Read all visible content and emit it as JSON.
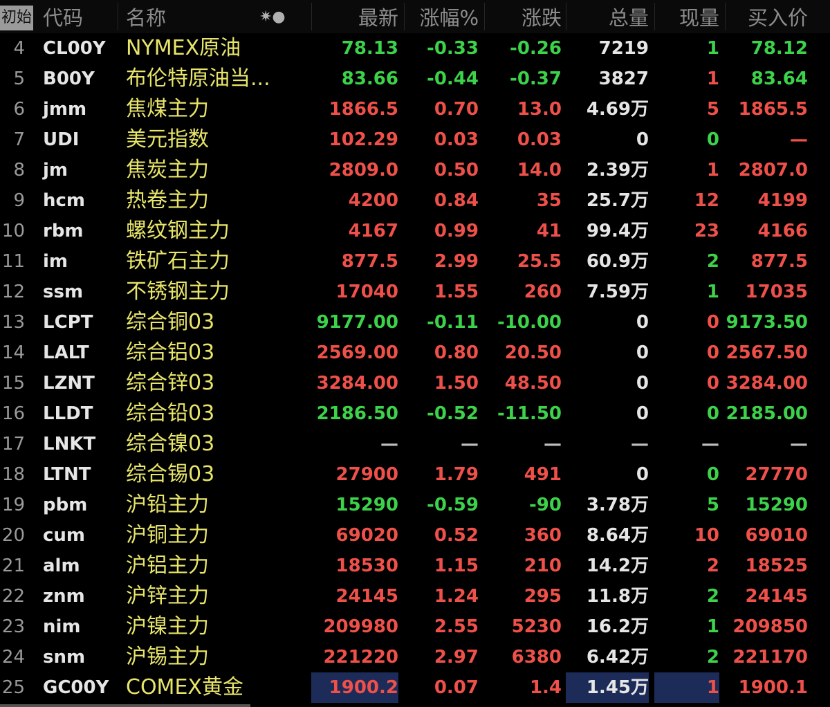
{
  "header": {
    "badge": "初始",
    "code": "代码",
    "name": "名称",
    "latest": "最新",
    "change_pct": "涨幅%",
    "change": "涨跌",
    "volume": "总量",
    "cur_volume": "现量",
    "bid": "买入价"
  },
  "colors": {
    "up": "#f0504a",
    "down": "#3cd24a",
    "name": "#e8e56a",
    "highlight": "#1d2b58"
  },
  "rows": [
    {
      "num": "4",
      "code": "CL00Y",
      "name": "NYMEX原油",
      "latest": "78.13",
      "pct": "-0.33",
      "chg": "-0.26",
      "vol": "7219",
      "cur": "1",
      "bid": "78.12",
      "dir": "dn",
      "voldir": "nt",
      "curdir": "dn"
    },
    {
      "num": "5",
      "code": "B00Y",
      "name": "布伦特原油当...",
      "latest": "83.66",
      "pct": "-0.44",
      "chg": "-0.37",
      "vol": "3827",
      "cur": "1",
      "bid": "83.64",
      "dir": "dn",
      "voldir": "nt",
      "curdir": "up"
    },
    {
      "num": "6",
      "code": "jmm",
      "name": "焦煤主力",
      "latest": "1866.5",
      "pct": "0.70",
      "chg": "13.0",
      "vol": "4.69万",
      "cur": "5",
      "bid": "1865.5",
      "dir": "up",
      "voldir": "nt",
      "curdir": "up"
    },
    {
      "num": "7",
      "code": "UDI",
      "name": "美元指数",
      "latest": "102.29",
      "pct": "0.03",
      "chg": "0.03",
      "vol": "0",
      "cur": "0",
      "bid": "—",
      "dir": "up",
      "voldir": "nt",
      "curdir": "dn"
    },
    {
      "num": "8",
      "code": "jm",
      "name": "焦炭主力",
      "latest": "2809.0",
      "pct": "0.50",
      "chg": "14.0",
      "vol": "2.39万",
      "cur": "1",
      "bid": "2807.0",
      "dir": "up",
      "voldir": "nt",
      "curdir": "up"
    },
    {
      "num": "9",
      "code": "hcm",
      "name": "热卷主力",
      "latest": "4200",
      "pct": "0.84",
      "chg": "35",
      "vol": "25.7万",
      "cur": "12",
      "bid": "4199",
      "dir": "up",
      "voldir": "nt",
      "curdir": "up"
    },
    {
      "num": "10",
      "code": "rbm",
      "name": "螺纹钢主力",
      "latest": "4167",
      "pct": "0.99",
      "chg": "41",
      "vol": "99.4万",
      "cur": "23",
      "bid": "4166",
      "dir": "up",
      "voldir": "nt",
      "curdir": "up"
    },
    {
      "num": "11",
      "code": "im",
      "name": "铁矿石主力",
      "latest": "877.5",
      "pct": "2.99",
      "chg": "25.5",
      "vol": "60.9万",
      "cur": "2",
      "bid": "877.5",
      "dir": "up",
      "voldir": "nt",
      "curdir": "dn"
    },
    {
      "num": "12",
      "code": "ssm",
      "name": "不锈钢主力",
      "latest": "17040",
      "pct": "1.55",
      "chg": "260",
      "vol": "7.59万",
      "cur": "1",
      "bid": "17035",
      "dir": "up",
      "voldir": "nt",
      "curdir": "dn"
    },
    {
      "num": "13",
      "code": "LCPT",
      "name": "综合铜03",
      "latest": "9177.00",
      "pct": "-0.11",
      "chg": "-10.00",
      "vol": "0",
      "cur": "0",
      "bid": "9173.50",
      "dir": "dn",
      "voldir": "nt",
      "curdir": "up"
    },
    {
      "num": "14",
      "code": "LALT",
      "name": "综合铝03",
      "latest": "2569.00",
      "pct": "0.80",
      "chg": "20.50",
      "vol": "0",
      "cur": "0",
      "bid": "2567.50",
      "dir": "up",
      "voldir": "nt",
      "curdir": "up"
    },
    {
      "num": "15",
      "code": "LZNT",
      "name": "综合锌03",
      "latest": "3284.00",
      "pct": "1.50",
      "chg": "48.50",
      "vol": "0",
      "cur": "0",
      "bid": "3284.00",
      "dir": "up",
      "voldir": "nt",
      "curdir": "up"
    },
    {
      "num": "16",
      "code": "LLDT",
      "name": "综合铅03",
      "latest": "2186.50",
      "pct": "-0.52",
      "chg": "-11.50",
      "vol": "0",
      "cur": "0",
      "bid": "2185.00",
      "dir": "dn",
      "voldir": "nt",
      "curdir": "dn"
    },
    {
      "num": "17",
      "code": "LNKT",
      "name": "综合镍03",
      "latest": "—",
      "pct": "—",
      "chg": "—",
      "vol": "—",
      "cur": "—",
      "bid": "—",
      "dir": "dash",
      "voldir": "dash",
      "curdir": "dash"
    },
    {
      "num": "18",
      "code": "LTNT",
      "name": "综合锡03",
      "latest": "27900",
      "pct": "1.79",
      "chg": "491",
      "vol": "0",
      "cur": "0",
      "bid": "27770",
      "dir": "up",
      "voldir": "nt",
      "curdir": "dn"
    },
    {
      "num": "19",
      "code": "pbm",
      "name": "沪铅主力",
      "latest": "15290",
      "pct": "-0.59",
      "chg": "-90",
      "vol": "3.78万",
      "cur": "5",
      "bid": "15290",
      "dir": "dn",
      "voldir": "nt",
      "curdir": "dn"
    },
    {
      "num": "20",
      "code": "cum",
      "name": "沪铜主力",
      "latest": "69020",
      "pct": "0.52",
      "chg": "360",
      "vol": "8.64万",
      "cur": "10",
      "bid": "69010",
      "dir": "up",
      "voldir": "nt",
      "curdir": "up"
    },
    {
      "num": "21",
      "code": "alm",
      "name": "沪铝主力",
      "latest": "18530",
      "pct": "1.15",
      "chg": "210",
      "vol": "14.2万",
      "cur": "2",
      "bid": "18525",
      "dir": "up",
      "voldir": "nt",
      "curdir": "up"
    },
    {
      "num": "22",
      "code": "znm",
      "name": "沪锌主力",
      "latest": "24145",
      "pct": "1.24",
      "chg": "295",
      "vol": "11.8万",
      "cur": "2",
      "bid": "24145",
      "dir": "up",
      "voldir": "nt",
      "curdir": "dn"
    },
    {
      "num": "23",
      "code": "nim",
      "name": "沪镍主力",
      "latest": "209980",
      "pct": "2.55",
      "chg": "5230",
      "vol": "16.2万",
      "cur": "1",
      "bid": "209850",
      "dir": "up",
      "voldir": "nt",
      "curdir": "dn"
    },
    {
      "num": "24",
      "code": "snm",
      "name": "沪锡主力",
      "latest": "221220",
      "pct": "2.97",
      "chg": "6380",
      "vol": "6.42万",
      "cur": "2",
      "bid": "221170",
      "dir": "up",
      "voldir": "nt",
      "curdir": "dn"
    },
    {
      "num": "25",
      "code": "GC00Y",
      "name": "COMEX黄金",
      "latest": "1900.2",
      "pct": "0.07",
      "chg": "1.4",
      "vol": "1.45万",
      "cur": "1",
      "bid": "1900.1",
      "dir": "up",
      "voldir": "nt",
      "curdir": "up",
      "highlight": true
    }
  ]
}
